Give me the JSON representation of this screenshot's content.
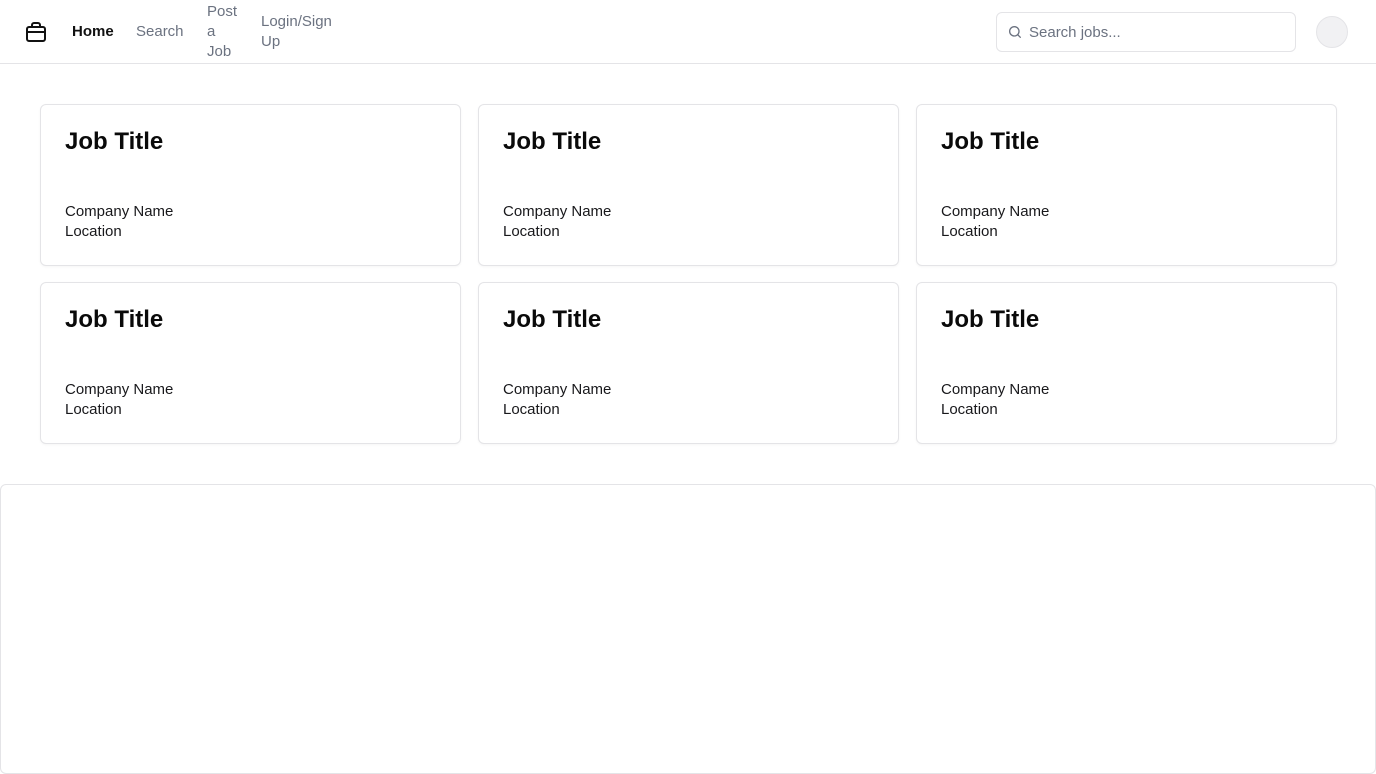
{
  "nav": {
    "home": "Home",
    "search": "Search",
    "post_job": "Post a Job",
    "login": "Login/Sign Up"
  },
  "search": {
    "placeholder": "Search jobs...",
    "value": ""
  },
  "icons": {
    "logo": "briefcase-icon",
    "search": "search-icon"
  },
  "jobs": [
    {
      "title": "Job Title",
      "company": "Company Name",
      "location": "Location"
    },
    {
      "title": "Job Title",
      "company": "Company Name",
      "location": "Location"
    },
    {
      "title": "Job Title",
      "company": "Company Name",
      "location": "Location"
    },
    {
      "title": "Job Title",
      "company": "Company Name",
      "location": "Location"
    },
    {
      "title": "Job Title",
      "company": "Company Name",
      "location": "Location"
    },
    {
      "title": "Job Title",
      "company": "Company Name",
      "location": "Location"
    }
  ],
  "colors": {
    "border": "#e4e4e7",
    "muted_text": "#6b7280",
    "primary_text": "#111111"
  }
}
